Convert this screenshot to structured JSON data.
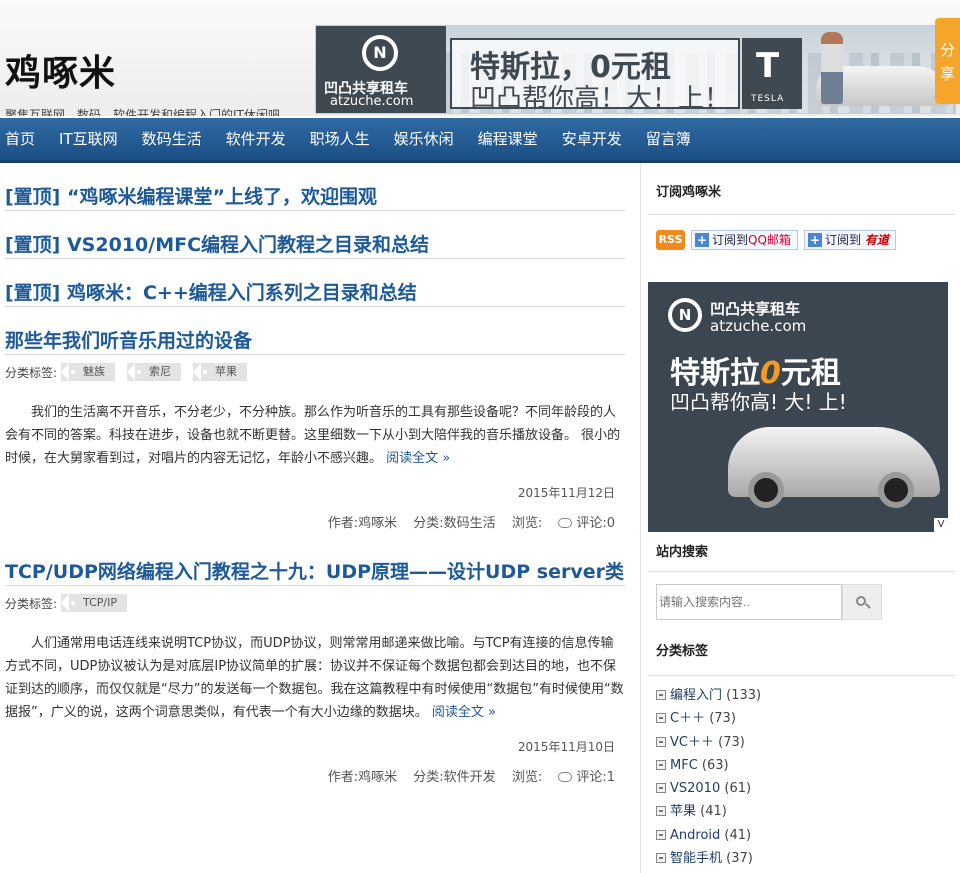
{
  "site": {
    "title": "鸡啄米",
    "description": "聚焦互联网、数码、软件开发和编程入门的IT休闲吧"
  },
  "banner": {
    "brand_cn": "凹凸共享租车",
    "brand_url": "atzuche.com",
    "logo_letter": "N",
    "slogan_main": "特斯拉，0元租",
    "slogan_sub": "凹凸帮你高！大！上！",
    "car_brand": "TESLA",
    "car_brand_letter": "T"
  },
  "share_tab": "分享",
  "nav": {
    "items": [
      "首页",
      "IT互联网",
      "数码生活",
      "软件开发",
      "职场人生",
      "娱乐休闲",
      "编程课堂",
      "安卓开发",
      "留言簿"
    ]
  },
  "sticky_posts": [
    "[置顶] “鸡啄米编程课堂”上线了，欢迎围观",
    "[置顶] VS2010/MFC编程入门教程之目录和总结",
    "[置顶] 鸡啄米：C++编程入门系列之目录和总结"
  ],
  "posts": [
    {
      "title": "那些年我们听音乐用过的设备",
      "tag_label": "分类标签:",
      "tags": [
        "魅族",
        "索尼",
        "苹果"
      ],
      "excerpt": "我们的生活离不开音乐，不分老少，不分种族。那么作为听音乐的工具有那些设备呢？不同年龄段的人会有不同的答案。科技在进步，设备也就不断更替。这里细数一下从小到大陪伴我的音乐播放设备。 很小的时候，在大舅家看到过，对唱片的内容无记忆，年龄小不感兴趣。",
      "read_more": "阅读全文 »",
      "date": "2015年11月12日",
      "author": "作者:鸡啄米",
      "category": "分类:数码生活",
      "views": "浏览:",
      "comments": "评论:0"
    },
    {
      "title": "TCP/UDP网络编程入门教程之十九：UDP原理——设计UDP server类",
      "tag_label": "分类标签:",
      "tags": [
        "TCP/IP"
      ],
      "excerpt": "人们通常用电话连线来说明TCP协议，而UDP协议，则常常用邮递来做比喻。与TCP有连接的信息传输方式不同，UDP协议被认为是对底层IP协议简单的扩展：协议并不保证每个数据包都会到达目的地，也不保证到达的顺序，而仅仅就是“尽力”的发送每一个数据包。我在这篇教程中有时候使用“数据包”有时候使用“数据报”，广义的说，这两个词意思类似，有代表一个有大小边缘的数据块。",
      "read_more": "阅读全文 »",
      "date": "2015年11月10日",
      "author": "作者:鸡啄米",
      "category": "分类:软件开发",
      "views": "浏览:",
      "comments": "评论:1"
    }
  ],
  "sidebar": {
    "subscribe_title": "订阅鸡啄米",
    "rss_label": "RSS",
    "plus_sign": "+",
    "qq_prefix": "订阅到",
    "qq_brand": "QQ邮箱",
    "youdao_prefix": "订阅到",
    "youdao_brand": "有道",
    "ad": {
      "logo_letter": "N",
      "brand_cn": "凹凸共享租车",
      "brand_url": "atzuche.com",
      "headline_a": "特斯拉",
      "headline_zero": "0",
      "headline_b": "元租",
      "sub": "凹凸帮你高! 大! 上!",
      "corner": "V"
    },
    "search_title": "站内搜索",
    "search_placeholder": "请输入搜索内容..",
    "categories_title": "分类标签",
    "categories": [
      {
        "name": "编程入门",
        "count": "(133)"
      },
      {
        "name": "C＋＋",
        "count": "(73)"
      },
      {
        "name": "VC＋＋",
        "count": "(73)"
      },
      {
        "name": "MFC",
        "count": "(63)"
      },
      {
        "name": "VS2010",
        "count": "(61)"
      },
      {
        "name": "苹果",
        "count": "(41)"
      },
      {
        "name": "Android",
        "count": "(41)"
      },
      {
        "name": "智能手机",
        "count": "(37)"
      }
    ]
  }
}
